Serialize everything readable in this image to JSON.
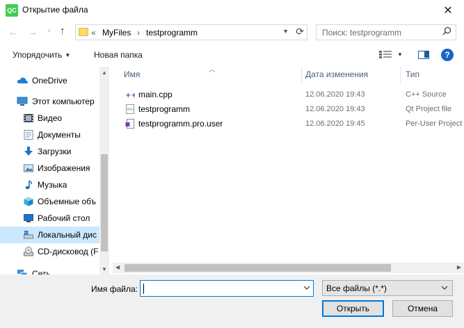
{
  "window": {
    "app_icon_text": "QC",
    "title": "Открытие файла",
    "close": "✕"
  },
  "navbar": {
    "back": "←",
    "forward": "→",
    "recent": "˅",
    "up": "↑",
    "address": {
      "overflow": "«",
      "segments": [
        "MyFiles",
        "testprogramm"
      ],
      "separator": "›"
    },
    "search_placeholder": "Поиск: testprogramm"
  },
  "commandbar": {
    "organize": "Упорядочить",
    "new_folder": "Новая папка"
  },
  "nav_items": [
    {
      "label": "OneDrive",
      "icon": "cloud-icon",
      "color": "#1b7fd6"
    },
    {
      "label": "Этот компьютер",
      "icon": "computer-icon",
      "color": "#3a8fd6"
    },
    {
      "label": "Видео",
      "icon": "video-icon",
      "color": "#444444"
    },
    {
      "label": "Документы",
      "icon": "documents-icon",
      "color": "#6a8fb5"
    },
    {
      "label": "Загрузки",
      "icon": "downloads-icon",
      "color": "#1e73c7"
    },
    {
      "label": "Изображения",
      "icon": "pictures-icon",
      "color": "#4f7fa8"
    },
    {
      "label": "Музыка",
      "icon": "music-icon",
      "color": "#1e73c7"
    },
    {
      "label": "Объемные объ",
      "icon": "3d-objects-icon",
      "color": "#39a9dc"
    },
    {
      "label": "Рабочий стол",
      "icon": "desktop-icon",
      "color": "#1e73c7"
    },
    {
      "label": "Локальный дис",
      "icon": "local-disk-icon",
      "color": "#5a7fa0"
    },
    {
      "label": "CD-дисковод (F",
      "icon": "cd-drive-icon",
      "color": "#888888"
    },
    {
      "label": "Сеть",
      "icon": "network-icon",
      "color": "#3a8fd6"
    }
  ],
  "columns": {
    "name": "Имя",
    "date": "Дата изменения",
    "type": "Тип"
  },
  "files": [
    {
      "name": "main.cpp",
      "date": "12.06.2020 19:43",
      "type": "C++ Source",
      "icon": "cpp-file-icon"
    },
    {
      "name": "testprogramm",
      "date": "12.06.2020 19:43",
      "type": "Qt Project file",
      "icon": "pro-file-icon"
    },
    {
      "name": "testprogramm.pro.user",
      "date": "12.06.2020 19:45",
      "type": "Per-User Project",
      "icon": "user-file-icon"
    }
  ],
  "bottom": {
    "filename_label": "Имя файла:",
    "filename_value": "",
    "filter": "Все файлы (*.*)",
    "open": "Открыть",
    "cancel": "Отмена"
  }
}
